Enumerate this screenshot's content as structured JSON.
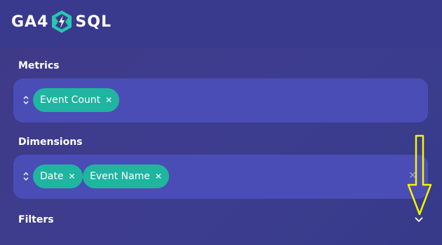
{
  "header": {
    "logo_left": "GA4",
    "logo_right": "SQL"
  },
  "metrics": {
    "label": "Metrics",
    "chips": [
      {
        "label": "Event Count",
        "remove": "✕"
      }
    ]
  },
  "dimensions": {
    "label": "Dimensions",
    "chips": [
      {
        "label": "Date",
        "remove": "✕"
      },
      {
        "label": "Event Name",
        "remove": "✕"
      }
    ],
    "clear": "✕"
  },
  "filters": {
    "label": "Filters"
  },
  "colors": {
    "background": "#3b3b8c",
    "select_box": "#4a4db6",
    "chip": "#1fb5a0",
    "annotation_arrow": "#f5f500"
  },
  "icons": [
    "logo-mark-icon",
    "sort-icon",
    "remove-icon",
    "chevron-down-icon",
    "annotation-arrow"
  ]
}
